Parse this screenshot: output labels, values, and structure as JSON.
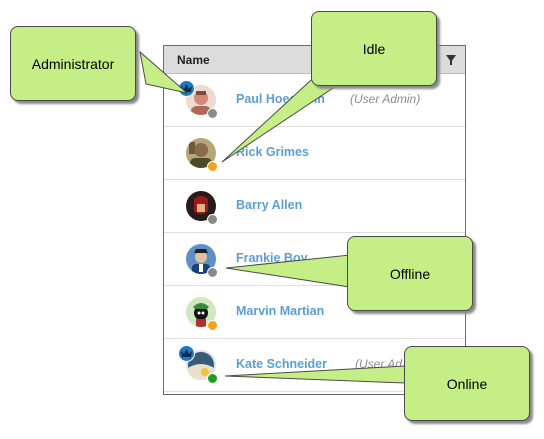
{
  "panel": {
    "header_label": "Name"
  },
  "users": [
    {
      "name": "Paul Hoecklein",
      "role": "(User Admin)",
      "admin": true,
      "status": "offline",
      "avatar_color": "#d08a7a",
      "avatar_bg": "#f0d9cf"
    },
    {
      "name": "Rick Grimes",
      "role": "",
      "admin": false,
      "status": "idle",
      "avatar_color": "#6b5b3a",
      "avatar_bg": "#b9a57a"
    },
    {
      "name": "Barry Allen",
      "role": "",
      "admin": false,
      "status": "offline",
      "avatar_color": "#9e1b1b",
      "avatar_bg": "#2a1a1a"
    },
    {
      "name": "Frankie Boy",
      "role": "",
      "admin": false,
      "status": "offline",
      "avatar_color": "#1d3f7a",
      "avatar_bg": "#5f8fc8"
    },
    {
      "name": "Marvin Martian",
      "role": "",
      "admin": false,
      "status": "idle",
      "avatar_color": "#3b8a3b",
      "avatar_bg": "#cfe8c2"
    },
    {
      "name": "Kate Schneider",
      "role": "(User Ad",
      "admin": true,
      "status": "online",
      "avatar_color": "#3a5a7a",
      "avatar_bg": "#d7e4ec"
    }
  ],
  "status_colors": {
    "online": "#1ea01e",
    "idle": "#f5a31a",
    "offline": "#8a8a8a"
  },
  "callouts": {
    "administrator": "Administrator",
    "idle": "Idle",
    "offline": "Offline",
    "online": "Online"
  },
  "colors": {
    "callout_fill": "#c6ee86",
    "name_link": "#5a9fd4",
    "crown_badge": "#1c79c2"
  }
}
